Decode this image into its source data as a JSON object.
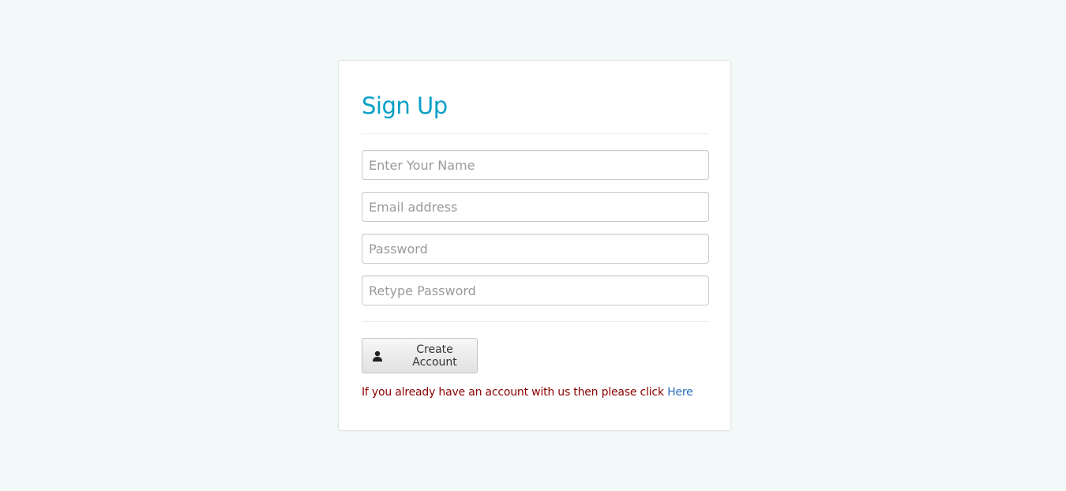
{
  "signup": {
    "title": "Sign Up",
    "fields": {
      "name_placeholder": "Enter Your Name",
      "email_placeholder": "Email address",
      "password_placeholder": "Password",
      "retype_placeholder": "Retype Password"
    },
    "create_button_label": "Create Account",
    "create_button_icon": "user-icon",
    "login_prompt": "If you already have an account with us then please click ",
    "login_link_label": "Here"
  },
  "colors": {
    "background": "#f2f9f8",
    "title": "#0aa0c6",
    "prompt_text": "#8b0000",
    "link": "#2a6ebd"
  }
}
